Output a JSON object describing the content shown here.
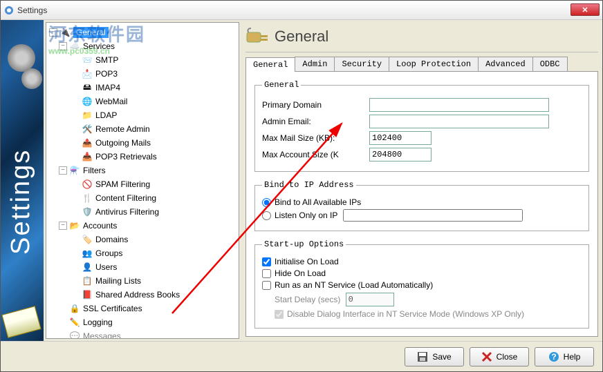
{
  "window": {
    "title": "Settings"
  },
  "watermark": {
    "line1": "河东软件园",
    "line2": "www.pc0359.cn"
  },
  "tree": {
    "root": "General",
    "groups": [
      {
        "label": "Services",
        "items": [
          "SMTP",
          "POP3",
          "IMAP4",
          "WebMail",
          "LDAP",
          "Remote Admin",
          "Outgoing Mails",
          "POP3 Retrievals"
        ]
      },
      {
        "label": "Filters",
        "items": [
          "SPAM Filtering",
          "Content Filtering",
          "Antivirus Filtering"
        ]
      },
      {
        "label": "Accounts",
        "items": [
          "Domains",
          "Groups",
          "Users",
          "Mailing Lists",
          "Shared Address Books"
        ]
      }
    ],
    "tail": [
      "SSL Certificates",
      "Logging",
      "Messages"
    ]
  },
  "panel": {
    "title": "General",
    "tabs": [
      "General",
      "Admin",
      "Security",
      "Loop Protection",
      "Advanced",
      "ODBC"
    ],
    "general": {
      "legend": "General",
      "primary_domain": {
        "label": "Primary Domain",
        "value": ""
      },
      "admin_email": {
        "label": "Admin Email:",
        "value": ""
      },
      "max_mail": {
        "label": "Max Mail Size (KB):",
        "value": "102400"
      },
      "max_acct": {
        "label": "Max Account Size (K",
        "value": "204800"
      }
    },
    "bind": {
      "legend": "Bind to IP Address",
      "opt1": "Bind to All Available IPs",
      "opt2": "Listen Only on IP",
      "opt2_val": ""
    },
    "startup": {
      "legend": "Start-up Options",
      "c1": "Initialise On Load",
      "c2": "Hide On Load",
      "c3": "Run as an NT Service  (Load Automatically)",
      "delay_label": "Start Delay (secs)",
      "delay_val": "0",
      "c4": "Disable Dialog Interface in NT Service Mode  (Windows XP Only)"
    }
  },
  "footer": {
    "save": "Save",
    "close": "Close",
    "help": "Help"
  },
  "sidebar_text": "Settings"
}
